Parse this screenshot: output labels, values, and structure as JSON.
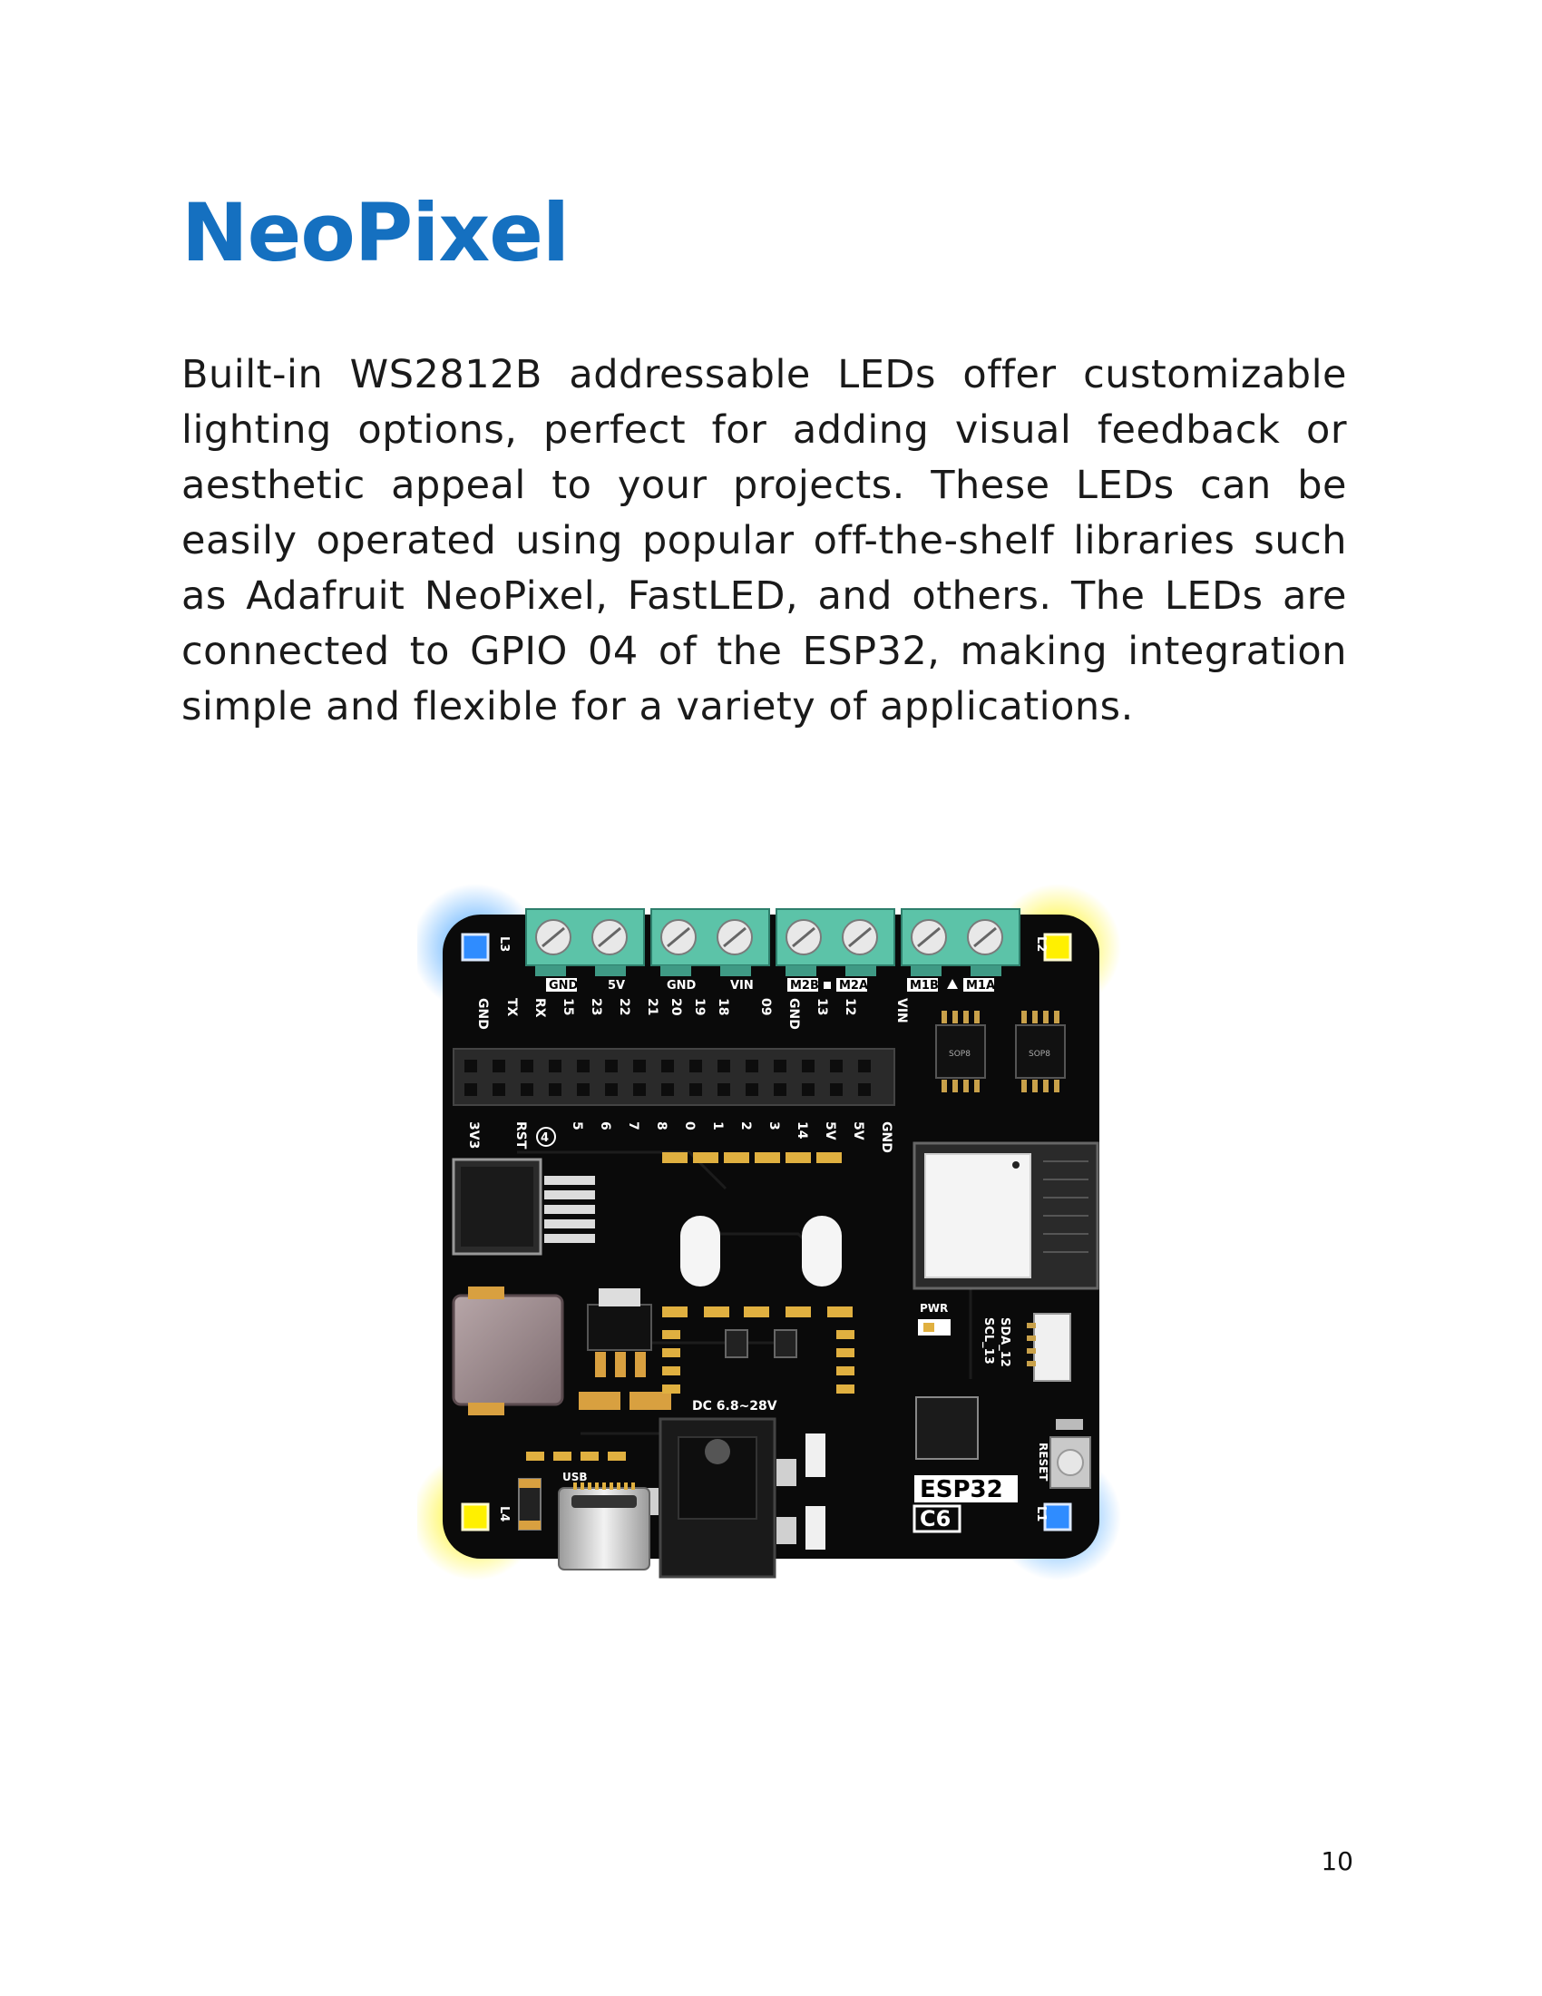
{
  "heading": "NeoPixel",
  "paragraph": "Built-in WS2812B addressable LEDs offer customizable lighting options, perfect for adding visual feedback or aesthetic appeal to your projects. These LEDs can be easily operated using popular off-the-shelf libraries such as Adafruit NeoPixel, FastLED, and others. The LEDs are connected to GPIO 04 of the ESP32, making integration simple and flexible for a variety of applications.",
  "board": {
    "led_labels": [
      "L1",
      "L2",
      "L3",
      "L4"
    ],
    "terminal_labels": [
      "GND",
      "5V",
      "GND",
      "VIN",
      "M2B",
      "M2A",
      "M1B",
      "M1A"
    ],
    "header_top_labels": [
      "GND",
      "TX",
      "RX",
      "15",
      "23",
      "22",
      "21",
      "20",
      "19",
      "18",
      "09",
      "GND",
      "13",
      "12",
      "VIN"
    ],
    "header_bottom_labels": [
      "3V3",
      "RST",
      "4",
      "5",
      "6",
      "7",
      "8",
      "0",
      "1",
      "2",
      "3",
      "14",
      "5V",
      "5V",
      "GND"
    ],
    "chip_labels": [
      "SOP8",
      "SOP8"
    ],
    "pwr_label": "PWR",
    "i2c_labels": [
      "SDA_12",
      "SCL_13"
    ],
    "reset_label": "RESET",
    "dc_label": "DC 6.8~28V",
    "usb_label": "USB",
    "model_line1": "ESP32",
    "model_line2": "C6",
    "colors": {
      "heading": "#1570c0",
      "pcb": "#0a0a0a",
      "terminal": "#5cc3a8",
      "led_blue": "#2f8cff",
      "led_yellow": "#fff000"
    }
  },
  "page_number": "10"
}
